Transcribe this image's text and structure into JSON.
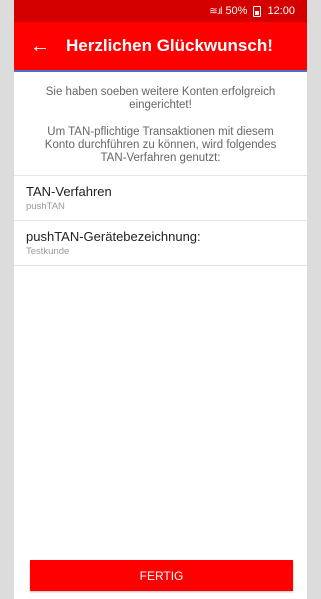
{
  "status_bar": {
    "signal": "≋.ıl",
    "battery": "50%",
    "time": "12:00",
    "icons": [
      "wifi-icon",
      "signal-icon",
      "battery-icon"
    ]
  },
  "app_bar": {
    "back_icon": "arrow-left-icon",
    "title": "Herzlichen Glückwunsch!"
  },
  "intro": {
    "line1": "Sie haben soeben weitere Konten erfolgreich eingerichtet!",
    "line2": "Um TAN-pflichtige Transaktionen mit diesem Konto durchführen zu können, wird folgendes TAN-Verfahren genutzt:"
  },
  "fields": [
    {
      "label": "TAN-Verfahren",
      "value": "pushTAN"
    },
    {
      "label": "pushTAN-Gerätebezeichnung:",
      "value": "Testkunde"
    }
  ],
  "footer": {
    "done_label": "FERTIG"
  },
  "colors": {
    "status_bar": "#d40000",
    "app_bar": "#ff0000",
    "accent_line": "#4b6ec8",
    "button": "#ff0000"
  }
}
